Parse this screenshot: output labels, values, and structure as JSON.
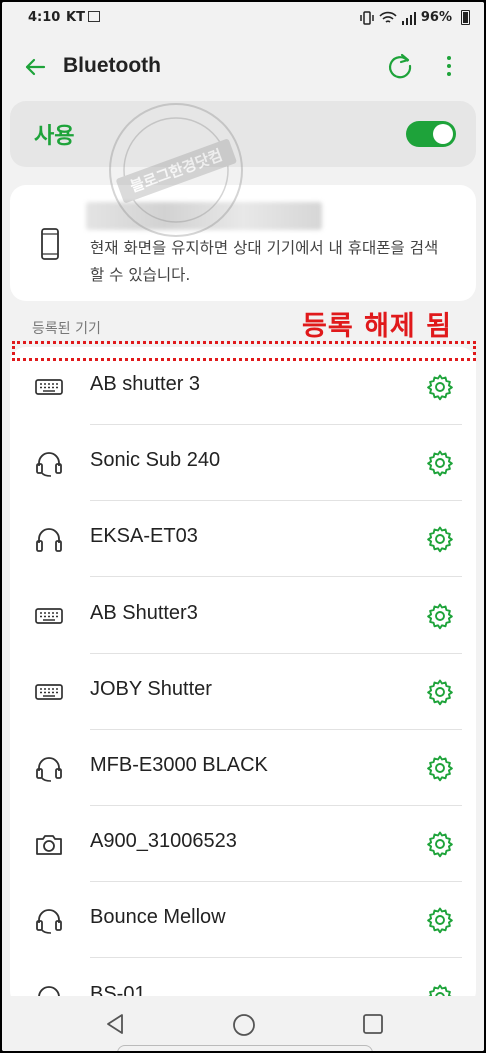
{
  "status_bar": {
    "time": "4:10",
    "carrier": "KT",
    "battery": "96%"
  },
  "header": {
    "title": "Bluetooth"
  },
  "toggle": {
    "label": "사용",
    "state": "on",
    "accent_color": "#1ea33a"
  },
  "visibility": {
    "description": "현재 화면을 유지하면 상대 기기에서 내 휴대폰을 검색할 수 있습니다."
  },
  "paired_section": {
    "title": "등록된 기기"
  },
  "annotation": {
    "text": "등록 해제 됨",
    "color": "#e0191b"
  },
  "watermark": {
    "text": "블로그한경닷컴"
  },
  "devices": [
    {
      "name": "AB shutter 3",
      "icon": "keyboard-icon"
    },
    {
      "name": "Sonic Sub 240",
      "icon": "headset-icon"
    },
    {
      "name": "EKSA-ET03",
      "icon": "headphones-icon"
    },
    {
      "name": "AB Shutter3",
      "icon": "keyboard-icon"
    },
    {
      "name": "JOBY Shutter",
      "icon": "keyboard-icon"
    },
    {
      "name": "MFB-E3000 BLACK",
      "icon": "headset-icon"
    },
    {
      "name": "A900_31006523",
      "icon": "camera-icon"
    },
    {
      "name": "Bounce Mellow",
      "icon": "headset-icon"
    },
    {
      "name": "BS-01",
      "icon": "headphones-icon"
    }
  ]
}
